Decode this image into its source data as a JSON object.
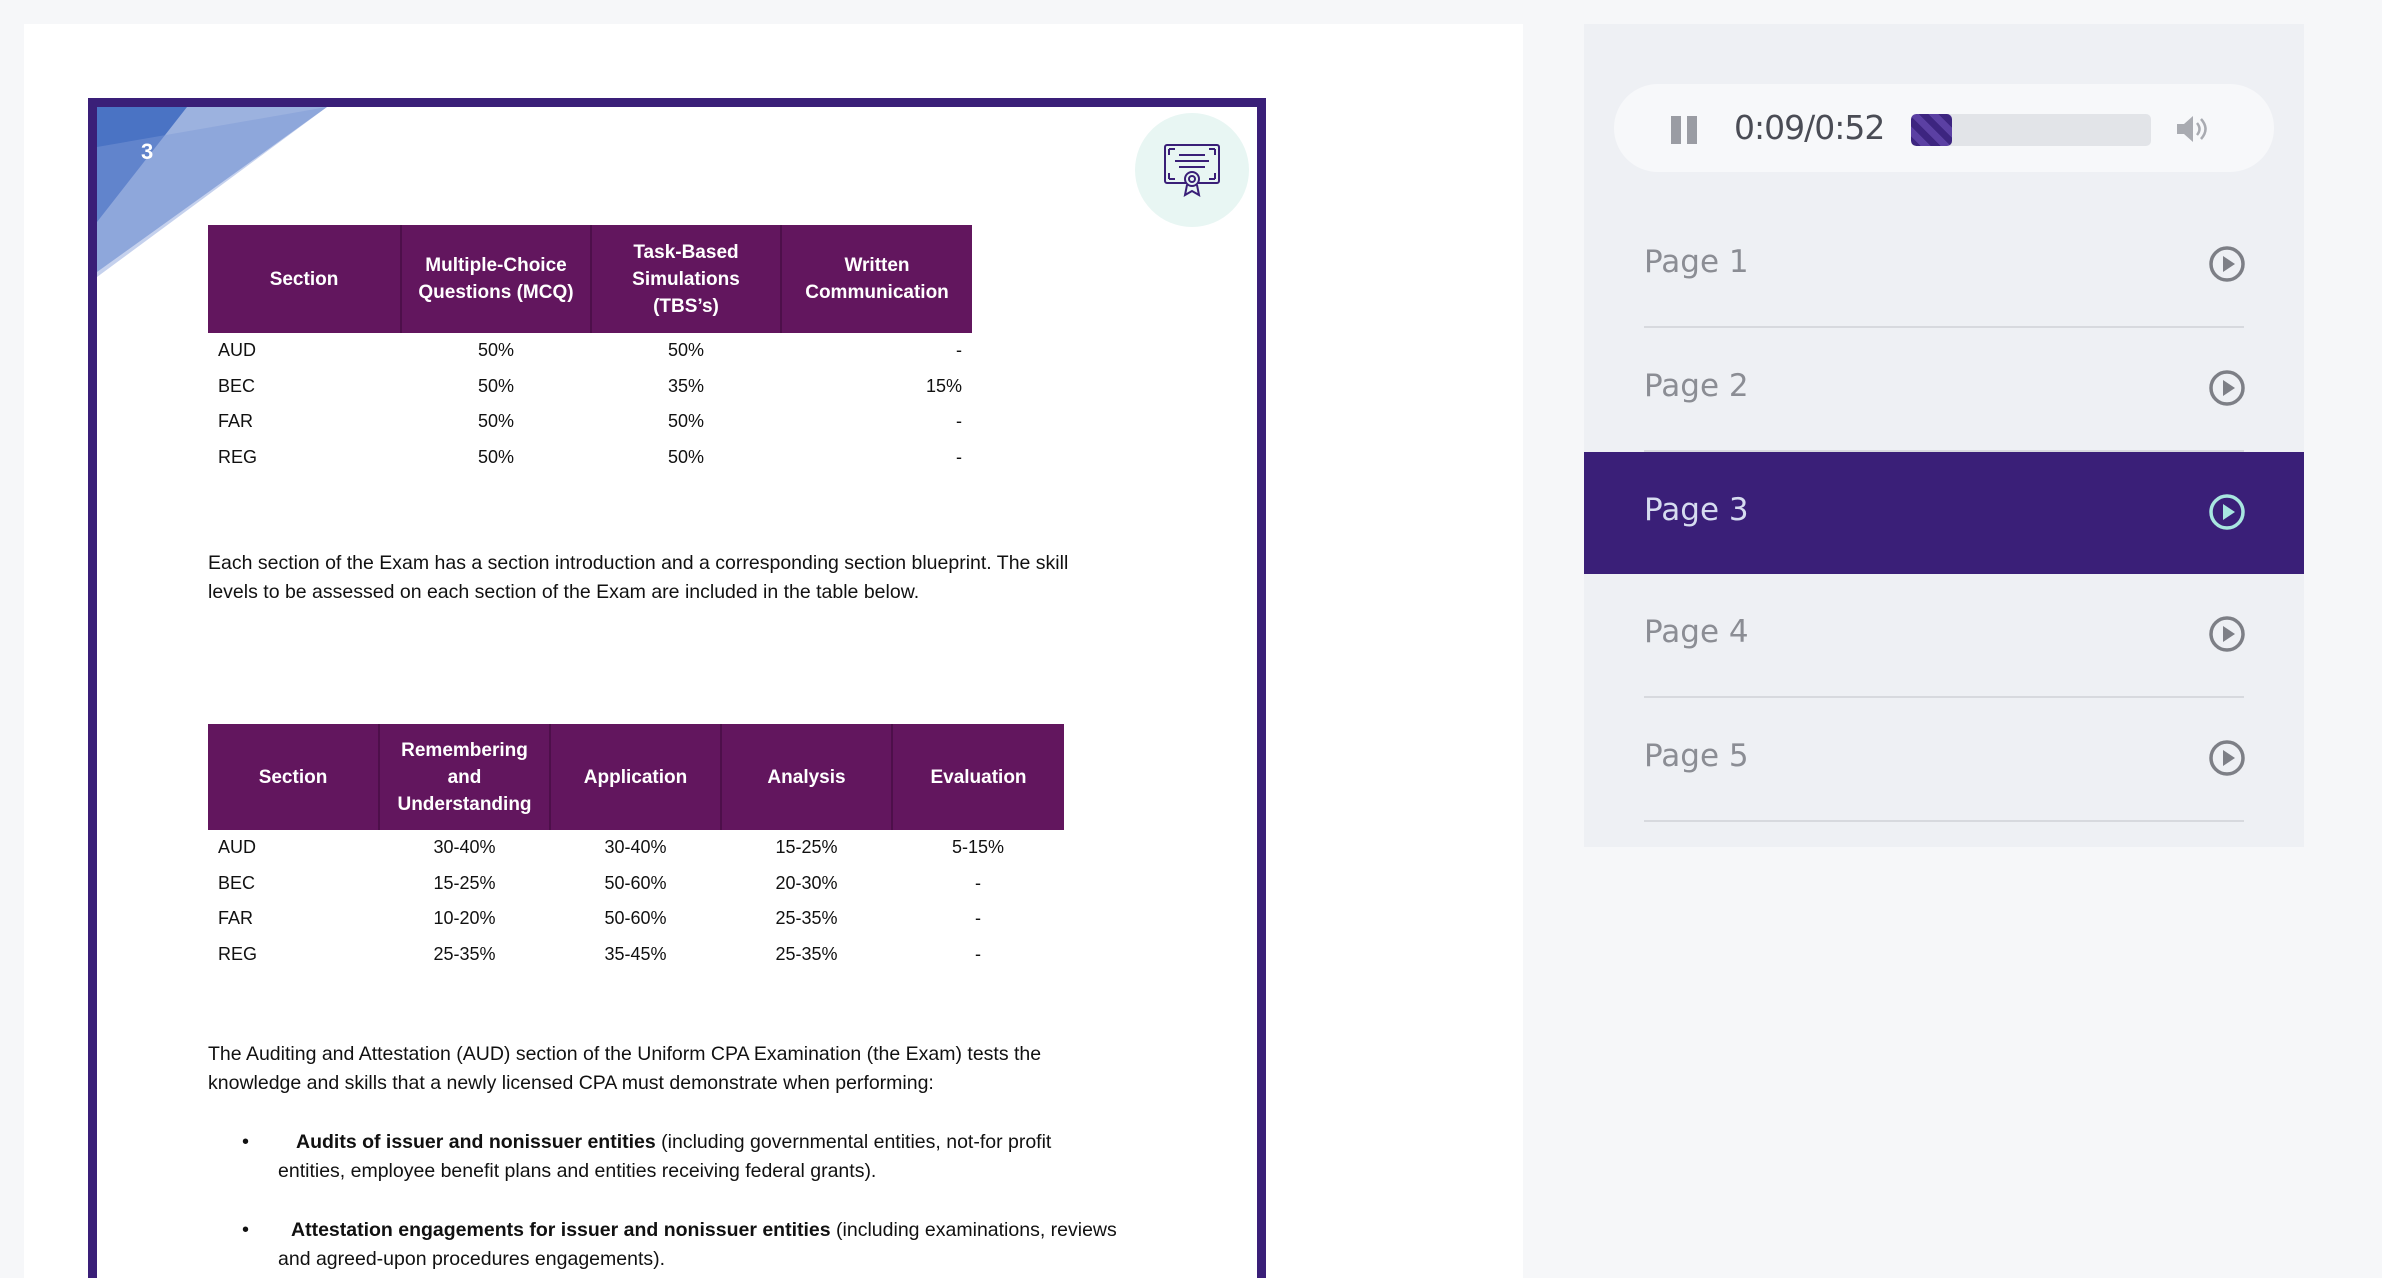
{
  "document": {
    "page_number": "3",
    "table1": {
      "headers": [
        [
          "Section"
        ],
        [
          "Multiple-Choice",
          "Questions (MCQ)"
        ],
        [
          "Task-Based",
          "Simulations",
          "(TBS’s)"
        ],
        [
          "Written",
          "Communication"
        ]
      ],
      "rows": [
        [
          "AUD",
          "50%",
          "50%",
          "-"
        ],
        [
          "BEC",
          "50%",
          "35%",
          "15%"
        ],
        [
          "FAR",
          "50%",
          "50%",
          "-"
        ],
        [
          "REG",
          "50%",
          "50%",
          "-"
        ]
      ]
    },
    "paragraph1_lines": [
      "Each section of the Exam has a section introduction and a corresponding section blueprint. The skill",
      "levels to be assessed on each section of the Exam are included in the table below."
    ],
    "table2": {
      "headers": [
        [
          "Section"
        ],
        [
          "Remembering",
          "and",
          "Understanding"
        ],
        [
          "Application"
        ],
        [
          "Analysis"
        ],
        [
          "Evaluation"
        ]
      ],
      "rows": [
        [
          "AUD",
          "30-40%",
          "30-40%",
          "15-25%",
          "5-15%"
        ],
        [
          "BEC",
          "15-25%",
          "50-60%",
          "20-30%",
          "-"
        ],
        [
          "FAR",
          "10-20%",
          "50-60%",
          "25-35%",
          "-"
        ],
        [
          "REG",
          "25-35%",
          "35-45%",
          "25-35%",
          "-"
        ]
      ]
    },
    "paragraph2_lines": [
      "The Auditing and Attestation (AUD) section of the Uniform CPA Examination (the Exam) tests the",
      "knowledge and skills that a newly licensed CPA must demonstrate when performing:"
    ],
    "bullets": [
      {
        "bold": "Audits of issuer and nonissuer entities",
        "rest_line1": " (including governmental entities, not-for profit",
        "line2": "entities, employee benefit plans and entities receiving federal grants)."
      },
      {
        "bold": "Attestation engagements for issuer and nonissuer entities",
        "rest_line1": " (including examinations, reviews",
        "line2": "and agreed-upon procedures engagements)."
      }
    ]
  },
  "player": {
    "time": "0:09/0:52",
    "progress": 0.17
  },
  "pages": [
    {
      "label": "Page 1",
      "active": false
    },
    {
      "label": "Page 2",
      "active": false
    },
    {
      "label": "Page 3",
      "active": true
    },
    {
      "label": "Page 4",
      "active": false
    },
    {
      "label": "Page 5",
      "active": false
    }
  ],
  "colors": {
    "page_border": "#3a1f78",
    "table_header": "#62165e",
    "active_item": "#3a1f78",
    "active_play_icon": "#a8e6e0",
    "progress_fill": "#3d2580"
  }
}
